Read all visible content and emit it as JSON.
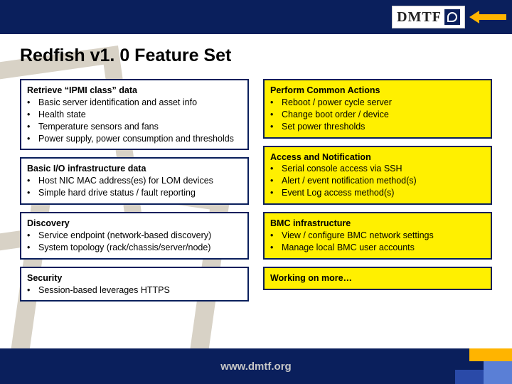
{
  "header": {
    "logo_text": "DMTF"
  },
  "title": "Redfish v1. 0 Feature Set",
  "left": [
    {
      "title": "Retrieve “IPMI class” data",
      "items": [
        "Basic server identification and asset info",
        "Health state",
        "Temperature sensors and fans",
        "Power supply, power consumption and thresholds"
      ]
    },
    {
      "title": "Basic I/O infrastructure data",
      "items": [
        "Host NIC MAC address(es) for LOM devices",
        "Simple hard drive status / fault reporting"
      ]
    },
    {
      "title": "Discovery",
      "items": [
        "Service endpoint (network-based discovery)",
        "System topology (rack/chassis/server/node)"
      ]
    },
    {
      "title": "Security",
      "items": [
        "Session-based leverages HTTPS"
      ]
    }
  ],
  "right": [
    {
      "title": "Perform Common Actions",
      "items": [
        "Reboot / power cycle server",
        "Change boot order / device",
        "Set power thresholds"
      ]
    },
    {
      "title": "Access and Notification",
      "items": [
        "Serial console access via SSH",
        "Alert / event notification method(s)",
        "Event Log access method(s)"
      ]
    },
    {
      "title": "BMC infrastructure",
      "items": [
        "View / configure BMC network settings",
        "Manage local BMC user accounts"
      ]
    },
    {
      "title": "Working on more…",
      "items": []
    }
  ],
  "footer": {
    "url": "www.dmtf.org"
  }
}
